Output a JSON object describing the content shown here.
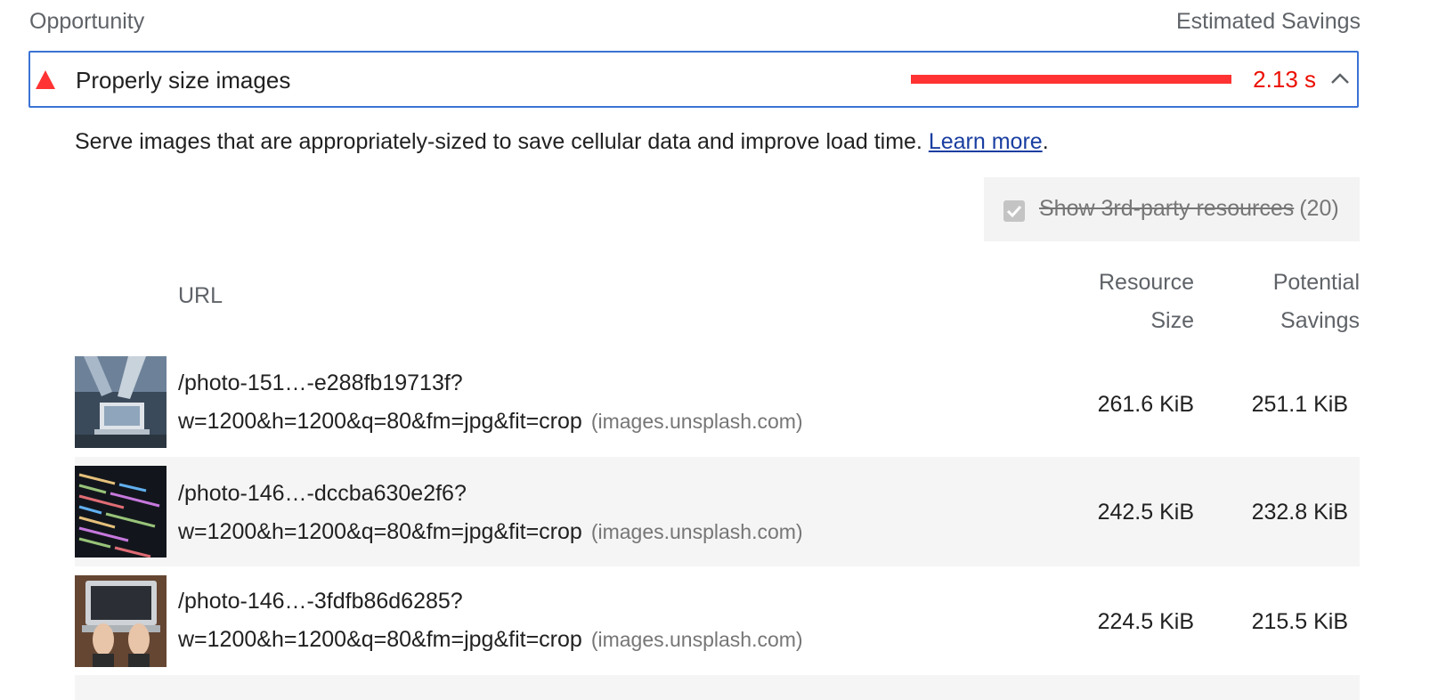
{
  "header": {
    "left": "Opportunity",
    "right": "Estimated Savings"
  },
  "audit": {
    "title": "Properly size images",
    "savings_display": "2.13 s",
    "savings_fraction": 1.0,
    "status_color": "#ff3333",
    "expanded": true,
    "description": "Serve images that are appropriately-sized to save cellular data and improve load time. ",
    "learn_more": "Learn more",
    "description_end": "."
  },
  "filter": {
    "label": "Show 3rd-party resources",
    "count": "(20)",
    "checked": true
  },
  "table": {
    "columns": {
      "url": "URL",
      "size_line1": "Resource",
      "size_line2": "Size",
      "savings_line1": "Potential",
      "savings_line2": "Savings"
    },
    "rows": [
      {
        "url_line1": "/photo-151…-e288fb19713f?",
        "url_line2": "w=1200&h=1200&q=80&fm=jpg&fit=crop",
        "host": "(images.unsplash.com)",
        "size": "261.6 KiB",
        "savings": "251.1 KiB",
        "thumb_icon": "people-laptop-photo"
      },
      {
        "url_line1": "/photo-146…-dccba630e2f6?",
        "url_line2": "w=1200&h=1200&q=80&fm=jpg&fit=crop",
        "host": "(images.unsplash.com)",
        "size": "242.5 KiB",
        "savings": "232.8 KiB",
        "thumb_icon": "code-screen-photo"
      },
      {
        "url_line1": "/photo-146…-3fdfb86d6285?",
        "url_line2": "w=1200&h=1200&q=80&fm=jpg&fit=crop",
        "host": "(images.unsplash.com)",
        "size": "224.5 KiB",
        "savings": "215.5 KiB",
        "thumb_icon": "hands-laptop-photo"
      }
    ]
  }
}
